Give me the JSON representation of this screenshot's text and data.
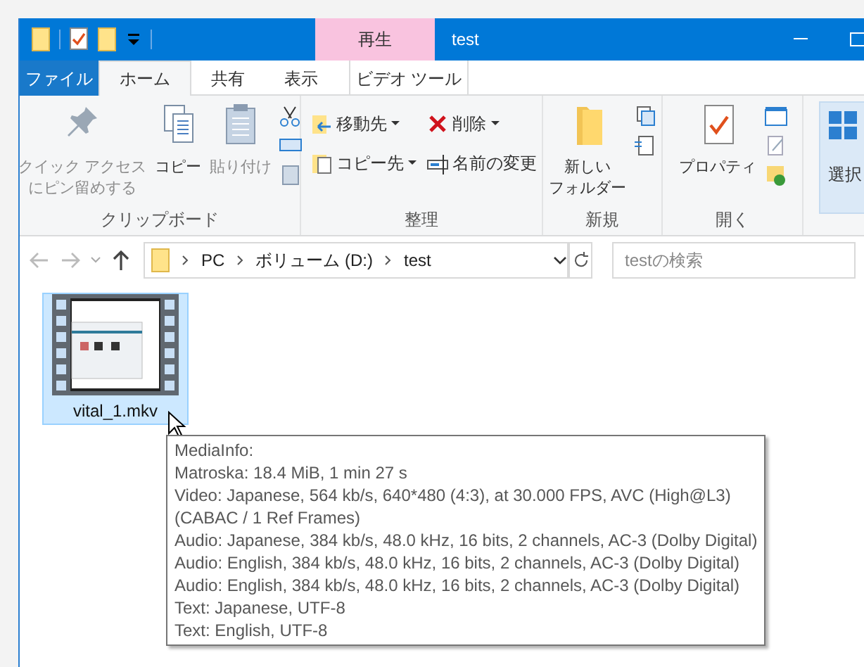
{
  "title_bar": {
    "context_tab": "再生",
    "title": "test"
  },
  "tabs": [
    {
      "label": "ファイル",
      "kind": "file",
      "selected": false
    },
    {
      "label": "ホーム",
      "kind": "normal",
      "selected": true
    },
    {
      "label": "共有",
      "kind": "normal",
      "selected": false
    },
    {
      "label": "表示",
      "kind": "normal",
      "selected": false
    },
    {
      "label": "ビデオ ツール",
      "kind": "contextual",
      "selected": false
    }
  ],
  "ribbon": {
    "groups": [
      {
        "label": "クリップボード",
        "buttons": [
          {
            "label_lines": [
              "クイック アクセス",
              "にピン留めする"
            ],
            "kind": "large",
            "disabled": true
          },
          {
            "label": "コピー",
            "kind": "large",
            "disabled": false
          },
          {
            "label": "貼り付け",
            "kind": "large",
            "disabled": true
          },
          {
            "kind": "icons"
          }
        ]
      },
      {
        "label": "整理",
        "buttons": [
          {
            "label": "移動先",
            "kind": "small",
            "dropdown": true
          },
          {
            "label": "コピー先",
            "kind": "small",
            "dropdown": true
          },
          {
            "label": "削除",
            "kind": "small",
            "dropdown": true
          },
          {
            "label": "名前の変更",
            "kind": "small",
            "dropdown": false
          }
        ]
      },
      {
        "label": "新規",
        "buttons": [
          {
            "label_lines": [
              "新しい",
              "フォルダー"
            ],
            "kind": "large",
            "disabled": false
          },
          {
            "kind": "icons"
          }
        ]
      },
      {
        "label": "開く",
        "buttons": [
          {
            "label": "プロパティ",
            "kind": "large",
            "disabled": false
          },
          {
            "kind": "icons"
          }
        ]
      },
      {
        "buttons": [
          {
            "label": "選択",
            "kind": "select",
            "disabled": false
          }
        ]
      }
    ]
  },
  "address": {
    "path": [
      "PC",
      "ボリューム (D:)",
      "test"
    ],
    "search_placeholder": "testの検索"
  },
  "files": [
    {
      "name": "vital_1.mkv",
      "selected": true
    }
  ],
  "tooltip": [
    "MediaInfo:",
    "Matroska: 18.4 MiB, 1 min 27 s",
    "Video: Japanese, 564 kb/s, 640*480 (4:3), at 30.000 FPS, AVC (High@L3)",
    "(CABAC / 1 Ref Frames)",
    "Audio: Japanese, 384 kb/s, 48.0 kHz, 16 bits, 2 channels, AC-3 (Dolby Digital)",
    "Audio: English, 384 kb/s, 48.0 kHz, 16 bits, 2 channels, AC-3 (Dolby Digital)",
    "Audio: English, 384 kb/s, 48.0 kHz, 16 bits, 2 channels, AC-3 (Dolby Digital)",
    "Text: Japanese, UTF-8",
    "Text: English, UTF-8"
  ]
}
